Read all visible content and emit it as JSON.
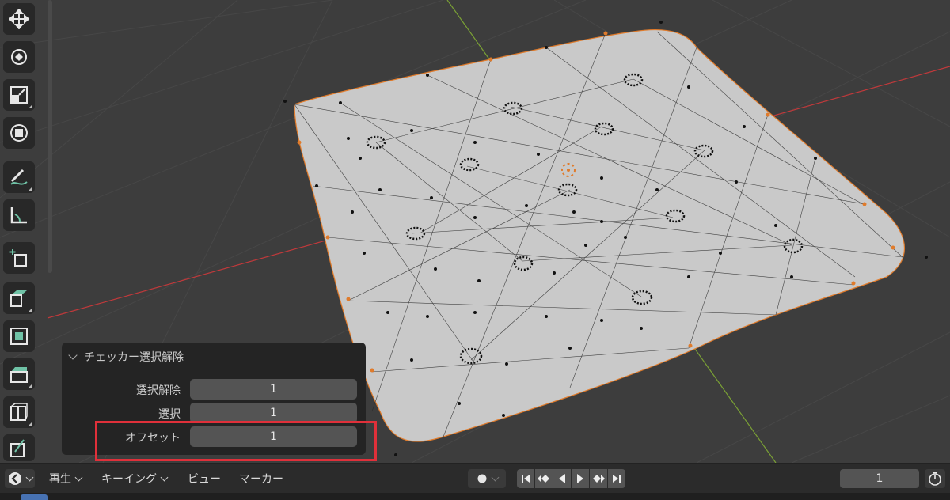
{
  "panel": {
    "title": "チェッカー選択解除",
    "props": [
      {
        "label": "選択解除",
        "value": "1"
      },
      {
        "label": "選択",
        "value": "1"
      },
      {
        "label": "オフセット",
        "value": "1"
      }
    ]
  },
  "timeline": {
    "playback_label": "再生",
    "keying_label": "キーイング",
    "view_label": "ビュー",
    "marker_label": "マーカー",
    "current_frame": "1"
  },
  "toolbar": {
    "tools": [
      "move-icon",
      "rotate-icon",
      "scale-icon",
      "transform-icon",
      "annotate-icon",
      "measure-icon",
      "add-cube-icon",
      "extrude-icon",
      "inset-icon",
      "bevel-icon",
      "loop-cut-icon",
      "knife-icon"
    ]
  },
  "colors": {
    "viewport_bg": "#3d3d3d",
    "mesh_face": "#c9c9c9",
    "edge_select": "#e07b2b",
    "x_axis": "#c0393b",
    "y_axis": "#7aa035",
    "highlight_box": "#e0303a",
    "panel_bg": "#242424"
  }
}
